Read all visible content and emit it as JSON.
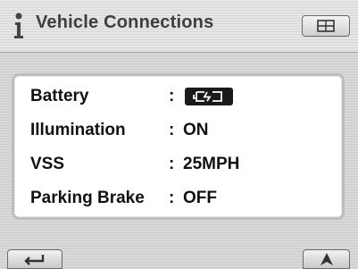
{
  "header": {
    "title": "Vehicle Connections",
    "info_icon": "info-icon",
    "menu_icon": "grid-menu-icon"
  },
  "rows": [
    {
      "label": "Battery",
      "separator": ":",
      "value": "",
      "value_icon": "battery-charging-icon"
    },
    {
      "label": "Illumination",
      "separator": ":",
      "value": "ON"
    },
    {
      "label": "VSS",
      "separator": ":",
      "value": "25MPH"
    },
    {
      "label": "Parking Brake",
      "separator": ":",
      "value": "OFF"
    }
  ],
  "footer": {
    "back_icon": "return-arrow-icon",
    "nav_icon": "navigation-arrow-icon"
  },
  "colors": {
    "title_text": "#3e3e3e",
    "panel_bg": "#ffffff",
    "value_text": "#111111"
  }
}
